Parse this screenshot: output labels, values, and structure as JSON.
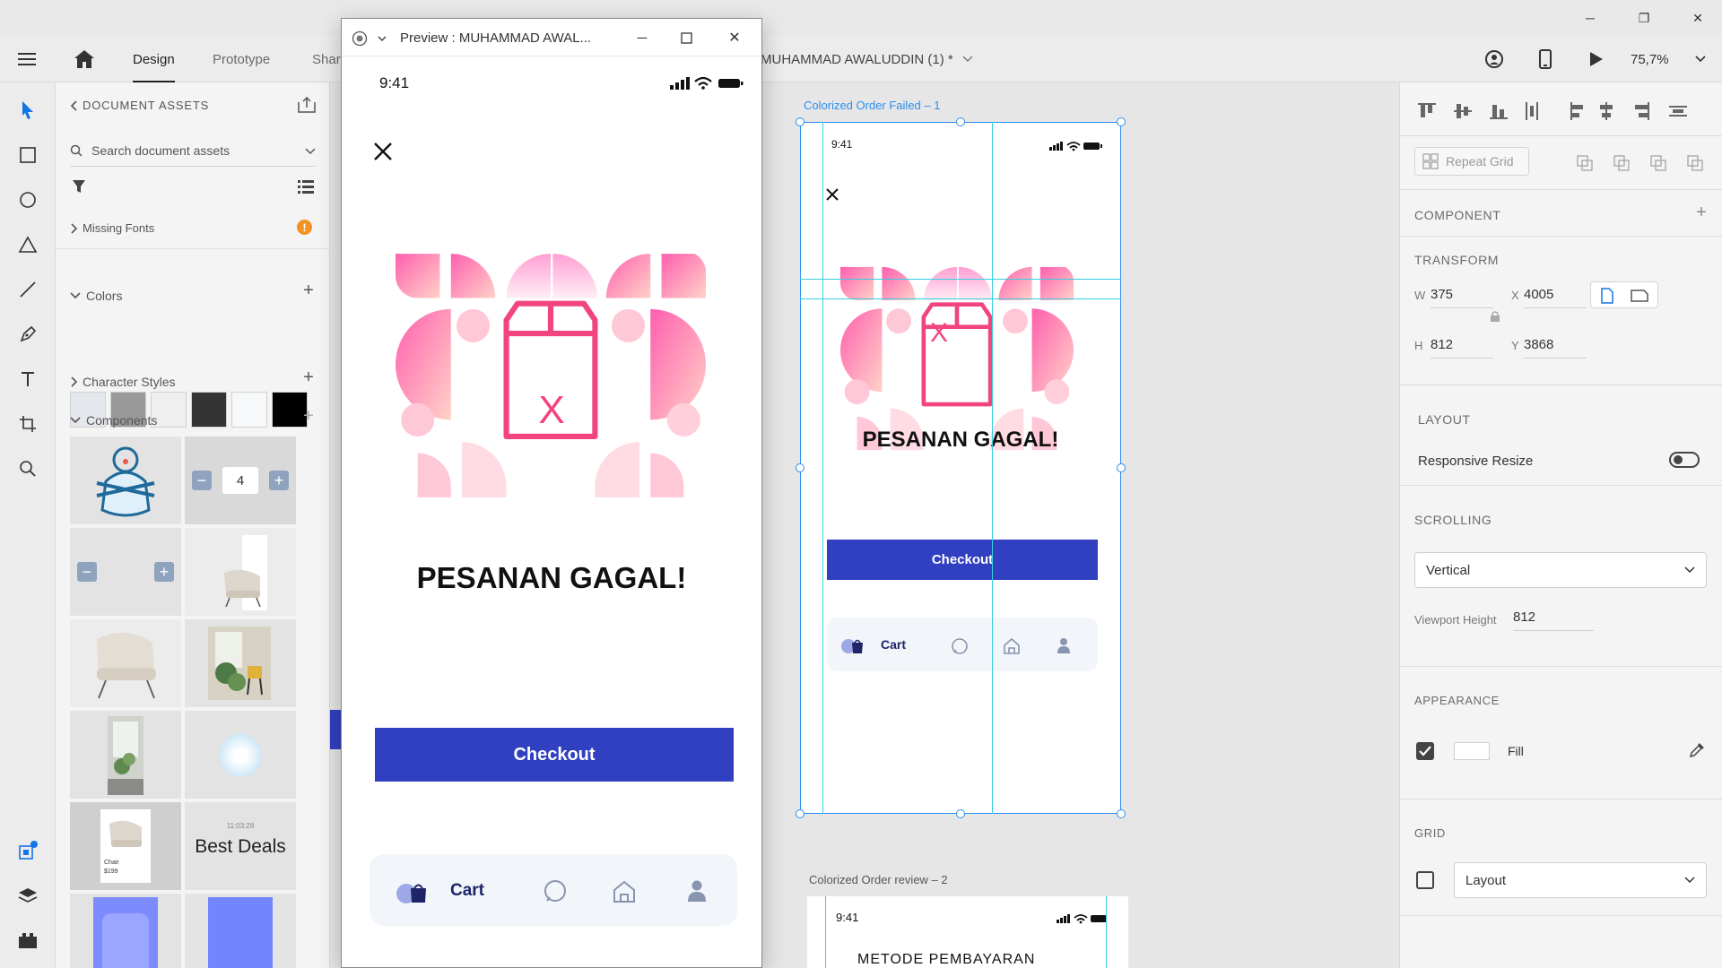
{
  "window": {
    "minimize": "─",
    "restore": "❐",
    "close": "✕"
  },
  "topbar": {
    "tabs": [
      {
        "label": "Design"
      },
      {
        "label": "Prototype"
      },
      {
        "label": "Shar"
      }
    ],
    "document_title": "MUHAMMAD AWALUDDIN (1) *",
    "zoom": "75,7%"
  },
  "assets": {
    "header": "DOCUMENT ASSETS",
    "search_placeholder": "Search document assets",
    "missing_fonts": "Missing Fonts",
    "warning_badge": "!",
    "colors_label": "Colors",
    "colors": [
      "#e4e7eb",
      "#999999",
      "#efefef",
      "#333333",
      "#f7f8fa",
      "#000000"
    ],
    "character_styles_label": "Character Styles",
    "components_label": "Components",
    "stepper_value": "4",
    "component_time": "11:03:28",
    "best_deals": "Best Deals",
    "chair_caption": "Chair",
    "chair_price": "$199"
  },
  "preview": {
    "title": "Preview : MUHAMMAD AWAL...",
    "status_time": "9:41",
    "heading": "PESANAN GAGAL!",
    "box_mark": "X",
    "checkout": "Checkout",
    "nav_cart": "Cart"
  },
  "artboard1": {
    "label": "Colorized Order Failed – 1",
    "status_time": "9:41",
    "heading": "PESANAN GAGAL!",
    "box_mark": "X",
    "checkout": "Checkout",
    "nav_cart": "Cart"
  },
  "artboard2": {
    "label": "Colorized Order review – 2",
    "status_time": "9:41",
    "heading_partial": "METODE PEMBAYARAN"
  },
  "props": {
    "repeat_grid": "Repeat Grid",
    "component_label": "COMPONENT",
    "transform_label": "TRANSFORM",
    "w_label": "W",
    "w_value": "375",
    "x_label": "X",
    "x_value": "4005",
    "h_label": "H",
    "h_value": "812",
    "y_label": "Y",
    "y_value": "3868",
    "layout_label": "LAYOUT",
    "responsive_resize": "Responsive Resize",
    "scrolling_label": "SCROLLING",
    "scrolling_value": "Vertical",
    "viewport_height_label": "Viewport Height",
    "viewport_height_value": "812",
    "appearance_label": "APPEARANCE",
    "fill_label": "Fill",
    "grid_label": "GRID",
    "grid_value": "Layout"
  },
  "theme": {
    "accent": "#3040c0",
    "pink": "#f2447e",
    "selection": "#2c8ff0",
    "guide": "#35d0e0"
  }
}
